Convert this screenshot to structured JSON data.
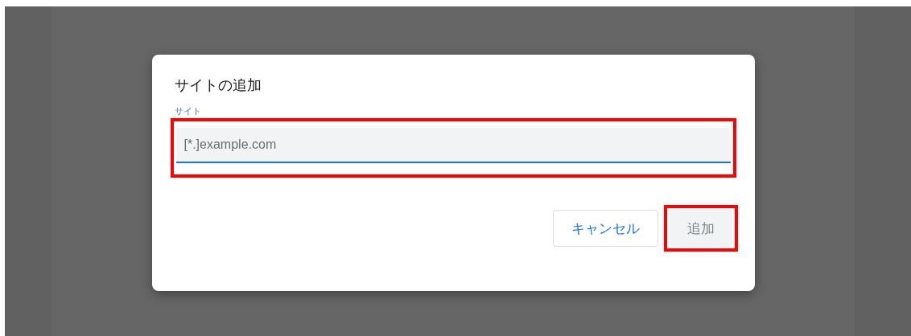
{
  "dialog": {
    "title": "サイトの追加",
    "field": {
      "label": "サイト",
      "placeholder": "[*.]example.com",
      "focused": true,
      "highlighted": true
    },
    "buttons": [
      {
        "kind": "cancel",
        "label": "キャンセル",
        "disabled": false,
        "highlighted": false
      },
      {
        "kind": "confirm",
        "label": "追加",
        "disabled": true,
        "highlighted": true
      }
    ]
  }
}
